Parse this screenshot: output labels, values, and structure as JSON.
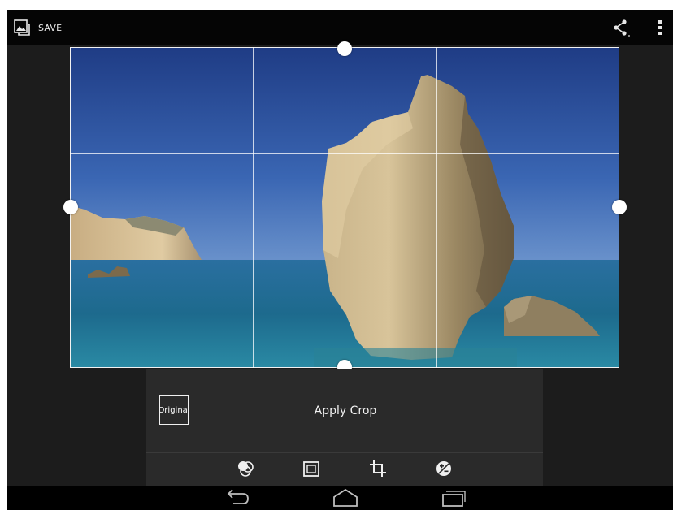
{
  "action_bar": {
    "save_label": "SAVE",
    "icons": [
      "gallery-icon",
      "share-icon",
      "overflow-menu-icon"
    ]
  },
  "crop": {
    "grid": "rule-of-thirds",
    "handles": [
      "top",
      "bottom",
      "left",
      "right"
    ],
    "frame_color": "#f2f2f2"
  },
  "panel": {
    "original_label": "Original",
    "apply_label": "Apply Crop"
  },
  "tools": [
    "filters-icon",
    "frames-icon",
    "crop-icon",
    "adjust-icon"
  ],
  "nav": [
    "back-icon",
    "home-icon",
    "recents-icon"
  ],
  "colors": {
    "action_bar": "#050505",
    "background": "#1c1c1c",
    "panel": "#2a2a2a",
    "nav_bar": "#000000"
  }
}
